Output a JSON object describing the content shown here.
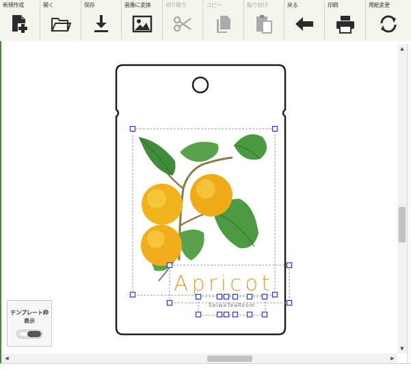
{
  "toolbar": {
    "items": [
      {
        "label": "新規作成",
        "icon": "new-document-icon",
        "enabled": true
      },
      {
        "label": "開く",
        "icon": "open-folder-icon",
        "enabled": true
      },
      {
        "label": "保存",
        "icon": "save-download-icon",
        "enabled": true
      },
      {
        "label": "画像に変換",
        "icon": "image-icon",
        "enabled": true
      },
      {
        "label": "切り取り",
        "icon": "scissors-icon",
        "enabled": false
      },
      {
        "label": "コピー",
        "icon": "copy-icon",
        "enabled": false
      },
      {
        "label": "貼り付け",
        "icon": "paste-icon",
        "enabled": false
      },
      {
        "label": "戻る",
        "icon": "back-arrow-icon",
        "enabled": true
      },
      {
        "label": "印刷",
        "icon": "printer-icon",
        "enabled": true
      },
      {
        "label": "用紙変更",
        "icon": "refresh-icon",
        "enabled": true
      }
    ]
  },
  "design": {
    "title_text": "Apricot",
    "subtitle_text": "SeiwaTeaRoom",
    "title_color": "#d4a23a"
  },
  "template_toggle": {
    "label_line1": "テンプレート枠",
    "label_line2": "表示",
    "state": "off"
  },
  "scrollbars": {
    "up_arrow": "▲",
    "down_arrow": "▼",
    "left_arrow": "◀",
    "right_arrow": "▶"
  },
  "colors": {
    "toolbar_bg": "#f4f5ec",
    "frame_green": "#3c8c3c",
    "selection_handle": "#2f3fd6"
  }
}
